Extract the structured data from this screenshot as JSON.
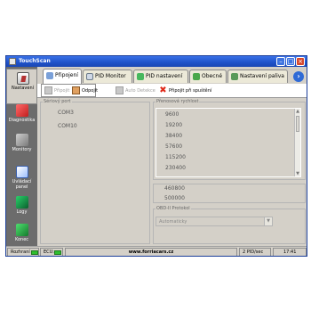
{
  "window": {
    "title": "TouchScan"
  },
  "sidebar": {
    "items": [
      {
        "label": "Nastavení",
        "icon": "settings-icon"
      },
      {
        "label": "Diagnostika",
        "icon": "diagnostics-icon"
      },
      {
        "label": "Monitory",
        "icon": "monitors-icon"
      },
      {
        "label": "Uvládací panel",
        "icon": "control-panel-icon"
      },
      {
        "label": "Logy",
        "icon": "logs-icon"
      },
      {
        "label": "Konec",
        "icon": "exit-icon"
      }
    ]
  },
  "tabs": [
    {
      "label": "Připojení",
      "active": true
    },
    {
      "label": "PID Monitor"
    },
    {
      "label": "PID nastavení"
    },
    {
      "label": "Obecné"
    },
    {
      "label": "Nastavení paliva"
    }
  ],
  "toolbar": {
    "connect": "Připojit",
    "disconnect": "Odpojit",
    "autodetect": "Auto Detekce",
    "connect_on_start": "Připojit při spuštění"
  },
  "serial_group": {
    "title": "Sériový port",
    "ports": [
      "COM3",
      "COM10"
    ]
  },
  "baud_group": {
    "title": "Přenosová rychlost",
    "rates": [
      "9600",
      "19200",
      "38400",
      "57600",
      "115200",
      "230400",
      "460800",
      "500000"
    ]
  },
  "protocol_group": {
    "title": "OBD-II Protokol",
    "selected": "Automaticky"
  },
  "statusbar": {
    "connection_label": "Rozhraní",
    "ecu_label": "ECU:",
    "url": "www.forriacars.cz",
    "rate": "2 PID/sec",
    "time": "17:41"
  },
  "colors": {
    "title_bar": "#1f52c9",
    "sidebar_bg": "#6c6c6c",
    "window_bg": "#d4d0c8",
    "led_on": "#2fbf2f"
  }
}
